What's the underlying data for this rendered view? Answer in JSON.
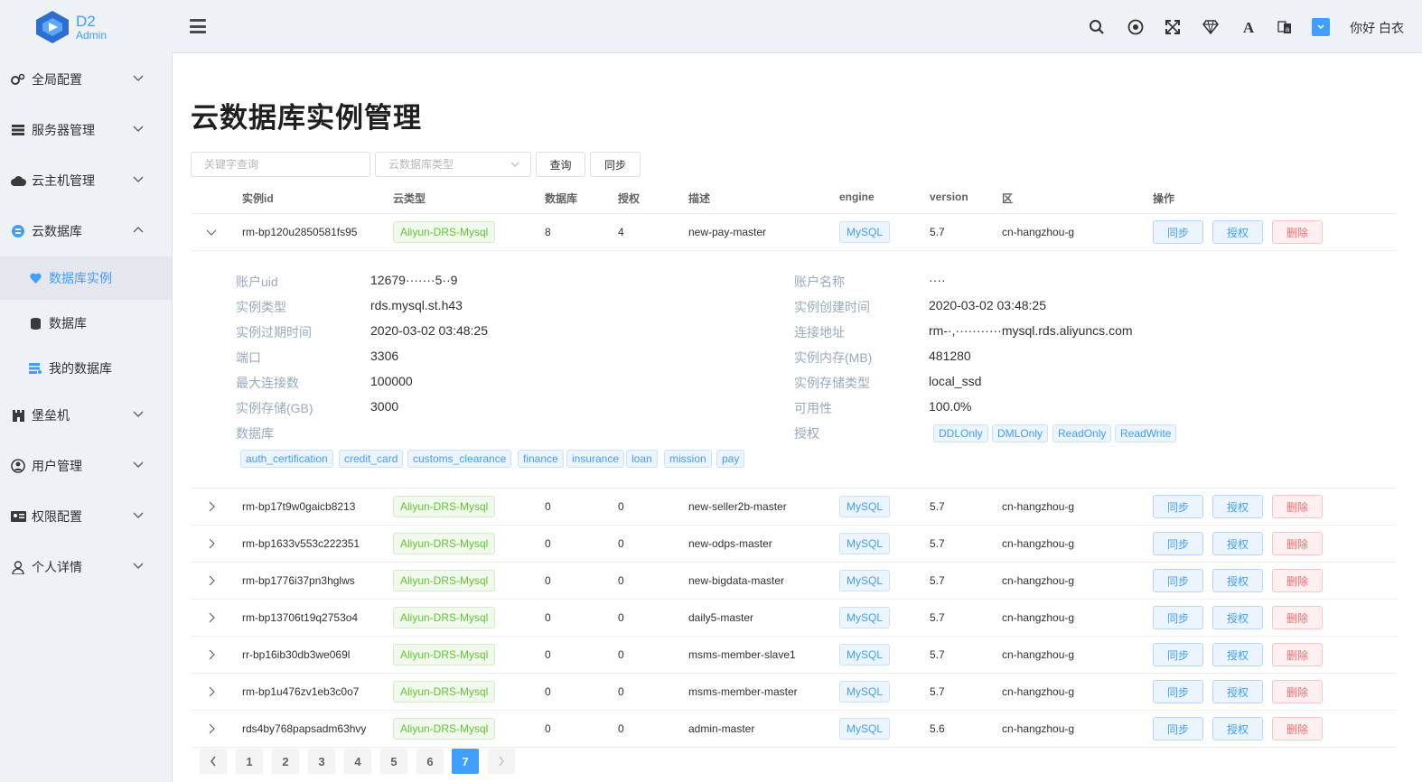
{
  "logo": {
    "title": "D2",
    "subtitle": "Admin"
  },
  "sidebar": {
    "items": [
      {
        "label": "全局配置"
      },
      {
        "label": "服务器管理"
      },
      {
        "label": "云主机管理"
      },
      {
        "label": "云数据库"
      },
      {
        "label": "数据库实例"
      },
      {
        "label": "数据库"
      },
      {
        "label": "我的数据库"
      },
      {
        "label": "堡垒机"
      },
      {
        "label": "用户管理"
      },
      {
        "label": "权限配置"
      },
      {
        "label": "个人详情"
      }
    ]
  },
  "header": {
    "greeting": "你好 白衣"
  },
  "page": {
    "title": "云数据库实例管理"
  },
  "toolbar": {
    "keyword_placeholder": "关键字查询",
    "type_placeholder": "云数据库类型",
    "query_label": "查询",
    "sync_label": "同步"
  },
  "table": {
    "columns": [
      "实例id",
      "云类型",
      "数据库",
      "授权",
      "描述",
      "engine",
      "version",
      "区",
      "操作"
    ],
    "actions": {
      "sync": "同步",
      "grant": "授权",
      "delete": "删除"
    },
    "rows": [
      {
        "id": "rm-bp120u2850581fs95",
        "cloud": "Aliyun-DRS-Mysql",
        "db": "8",
        "grant": "4",
        "desc": "new-pay-master",
        "engine": "MySQL",
        "version": "5.7",
        "zone": "cn-hangzhou-g"
      },
      {
        "id": "rm-bp17t9w0gaicb8213",
        "cloud": "Aliyun-DRS-Mysql",
        "db": "0",
        "grant": "0",
        "desc": "new-seller2b-master",
        "engine": "MySQL",
        "version": "5.7",
        "zone": "cn-hangzhou-g"
      },
      {
        "id": "rm-bp1633v553c222351",
        "cloud": "Aliyun-DRS-Mysql",
        "db": "0",
        "grant": "0",
        "desc": "new-odps-master",
        "engine": "MySQL",
        "version": "5.7",
        "zone": "cn-hangzhou-g"
      },
      {
        "id": "rm-bp1776i37pn3hglws",
        "cloud": "Aliyun-DRS-Mysql",
        "db": "0",
        "grant": "0",
        "desc": "new-bigdata-master",
        "engine": "MySQL",
        "version": "5.7",
        "zone": "cn-hangzhou-g"
      },
      {
        "id": "rm-bp13706t19q2753o4",
        "cloud": "Aliyun-DRS-Mysql",
        "db": "0",
        "grant": "0",
        "desc": "daily5-master",
        "engine": "MySQL",
        "version": "5.7",
        "zone": "cn-hangzhou-g"
      },
      {
        "id": "rr-bp16ib30db3we069l",
        "cloud": "Aliyun-DRS-Mysql",
        "db": "0",
        "grant": "0",
        "desc": "msms-member-slave1",
        "engine": "MySQL",
        "version": "5.7",
        "zone": "cn-hangzhou-g"
      },
      {
        "id": "rm-bp1u476zv1eb3c0o7",
        "cloud": "Aliyun-DRS-Mysql",
        "db": "0",
        "grant": "0",
        "desc": "msms-member-master",
        "engine": "MySQL",
        "version": "5.7",
        "zone": "cn-hangzhou-g"
      },
      {
        "id": "rds4by768papsadm63hvy",
        "cloud": "Aliyun-DRS-Mysql",
        "db": "0",
        "grant": "0",
        "desc": "admin-master",
        "engine": "MySQL",
        "version": "5.6",
        "zone": "cn-hangzhou-g"
      }
    ]
  },
  "detail": {
    "left": [
      {
        "label": "账户uid",
        "value": "12679·······5··9"
      },
      {
        "label": "实例类型",
        "value": "rds.mysql.st.h43"
      },
      {
        "label": "实例过期时间",
        "value": "2020-03-02 03:48:25"
      },
      {
        "label": "端口",
        "value": "3306"
      },
      {
        "label": "最大连接数",
        "value": "100000"
      },
      {
        "label": "实例存储(GB)",
        "value": "3000"
      },
      {
        "label": "数据库",
        "value": ""
      }
    ],
    "right": [
      {
        "label": "账户名称",
        "value": "····"
      },
      {
        "label": "实例创建时间",
        "value": "2020-03-02 03:48:25"
      },
      {
        "label": "连接地址",
        "value": "rm-·,···········mysql.rds.aliyuncs.com"
      },
      {
        "label": "实例内存(MB)",
        "value": "481280"
      },
      {
        "label": "实例存储类型",
        "value": "local_ssd"
      },
      {
        "label": "可用性",
        "value": "100.0%"
      },
      {
        "label": "授权",
        "value": ""
      }
    ],
    "databases": [
      "auth_certification",
      "credit_card",
      "customs_clearance",
      "finance",
      "insurance",
      "loan",
      "mission",
      "pay"
    ],
    "grants": [
      "DDLOnly",
      "DMLOnly",
      "ReadOnly",
      "ReadWrite"
    ]
  },
  "pagination": {
    "pages": [
      "1",
      "2",
      "3",
      "4",
      "5",
      "6",
      "7"
    ],
    "current": "7"
  },
  "colors": {
    "accent": "#409eff",
    "success": "#67c23a",
    "danger": "#f56c6c"
  }
}
